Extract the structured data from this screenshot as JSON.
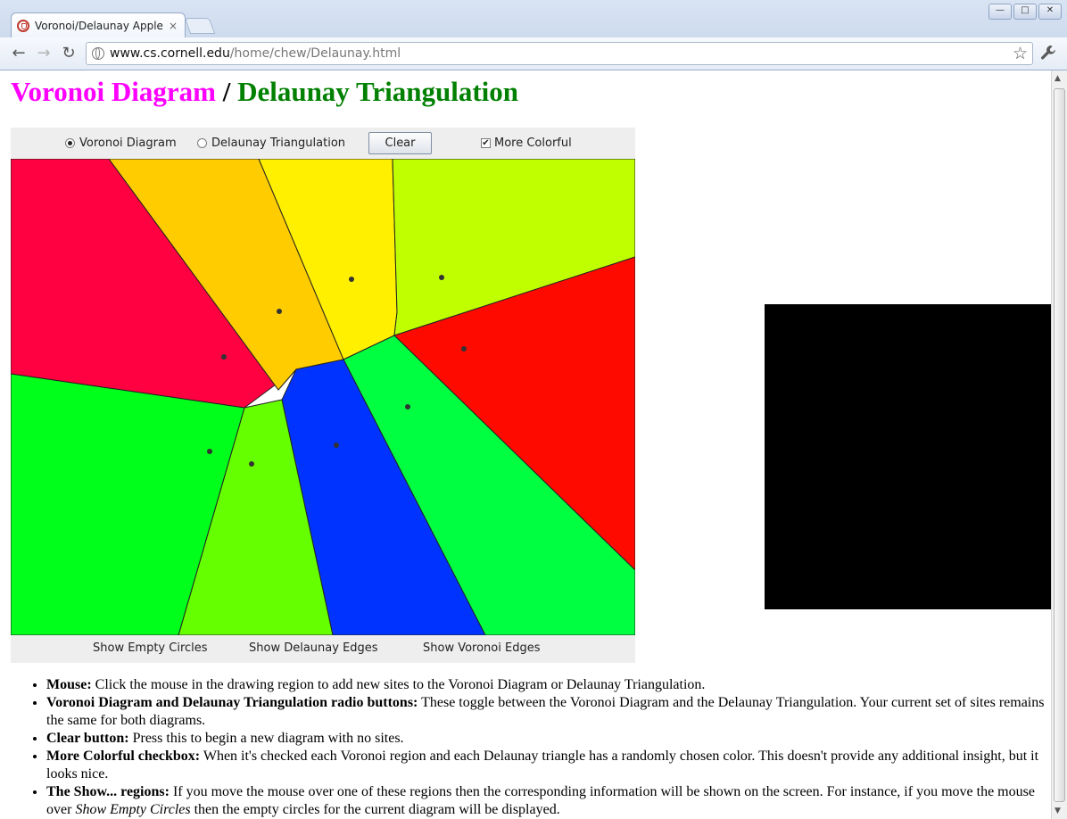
{
  "browser": {
    "tab_title": "Voronoi/Delaunay Apple",
    "tab_close": "×",
    "url_domain": "www.cs.cornell.edu",
    "url_path": "/home/chew/Delaunay.html",
    "minimize": "—",
    "maximize": "□",
    "close": "✕",
    "back_icon": "←",
    "forward_icon": "→",
    "reload_icon": "↻",
    "star_icon": "☆",
    "wrench_icon": "🔧"
  },
  "page": {
    "heading_voronoi": "Voronoi Diagram",
    "heading_separator": " / ",
    "heading_delaunay": "Delaunay Triangulation"
  },
  "applet": {
    "radio_voronoi": "Voronoi Diagram",
    "radio_delaunay": "Delaunay Triangulation",
    "selected_mode": "Voronoi Diagram",
    "clear_button": "Clear",
    "checkbox_label": "More Colorful",
    "checkbox_checked": true,
    "checkbox_mark": "✔",
    "show_empty_circles": "Show Empty Circles",
    "show_delaunay_edges": "Show Delaunay Edges",
    "show_voronoi_edges": "Show Voronoi Edges"
  },
  "colors": {
    "heading_voronoi": "#ff00ff",
    "heading_delaunay": "#008000",
    "regions": [
      "#ff0040",
      "#ffcc00",
      "#fff000",
      "#c0ff00",
      "#ff0a00",
      "#00ff40",
      "#0033ff",
      "#66ff00",
      "#00ff1a"
    ],
    "site": "#333333"
  },
  "help": [
    {
      "term": "Mouse:",
      "text": " Click the mouse in the drawing region to add new sites to the Voronoi Diagram or Delaunay Triangulation."
    },
    {
      "term": "Voronoi Diagram and Delaunay Triangulation radio buttons:",
      "text": " These toggle between the Voronoi Diagram and the Delaunay Triangulation. Your current set of sites remains the same for both diagrams."
    },
    {
      "term": "Clear button:",
      "text": " Press this to begin a new diagram with no sites."
    },
    {
      "term": "More Colorful checkbox:",
      "text": " When it's checked each Voronoi region and each Delaunay triangle has a randomly chosen color. This doesn't provide any additional insight, but it looks nice."
    },
    {
      "term": "The Show... regions:",
      "text": " If you move the mouse over one of these regions then the corresponding information will be shown on the screen. For instance, if you move the mouse over ",
      "em": "Show Empty Circles",
      "tail": " then the empty circles for the current diagram will be displayed."
    }
  ]
}
